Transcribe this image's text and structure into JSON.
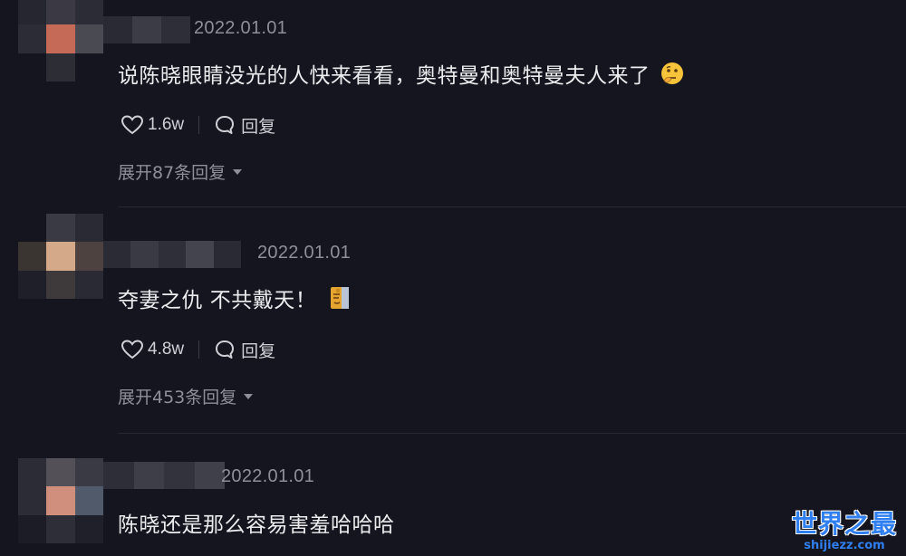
{
  "comments": [
    {
      "date": "2022.01.01",
      "text": "说陈晓眼睛没光的人快来看看，奥特曼和奥特曼夫人来了",
      "emoji": "thinking-face-emoji",
      "likes": "1.6w",
      "reply_label": "回复",
      "expand_label": "展开87条回复"
    },
    {
      "date": "2022.01.01",
      "text": "夺妻之仇 不共戴天！",
      "emoji": "moai-emoji",
      "likes": "4.8w",
      "reply_label": "回复",
      "expand_label": "展开453条回复"
    },
    {
      "date": "2022.01.01",
      "text": "陈晓还是那么容易害羞哈哈哈"
    }
  ],
  "watermark": {
    "title": "世界之最",
    "url": "shijiezz.com"
  },
  "colors": {
    "background": "#15151f",
    "text": "#ececef",
    "muted": "#8e8f99",
    "watermark": "#2f7ff0"
  }
}
